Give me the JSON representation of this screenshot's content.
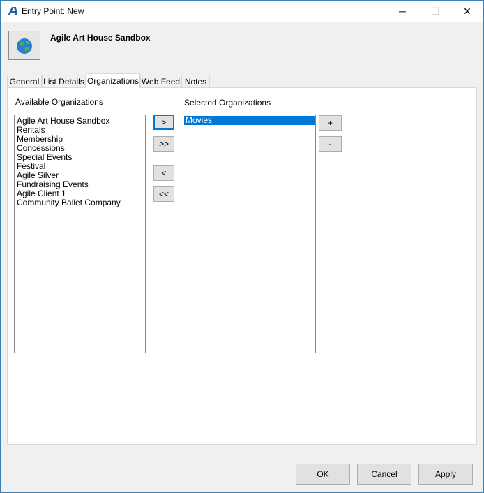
{
  "window": {
    "title": "Entry Point: New",
    "minimize_glyph": "─",
    "maximize_glyph": "☐",
    "close_glyph": "✕"
  },
  "header": {
    "title": "Agile Art House Sandbox"
  },
  "tabs": [
    {
      "label": "General"
    },
    {
      "label": "List Details"
    },
    {
      "label": "Organizations"
    },
    {
      "label": "Web Feed"
    },
    {
      "label": "Notes"
    }
  ],
  "active_tab": "Organizations",
  "organizations": {
    "available_label": "Available Organizations",
    "selected_label": "Selected Organizations",
    "available": [
      "Agile Art House Sandbox",
      "Rentals",
      "Membership",
      "Concessions",
      "Special Events",
      "Festival",
      "Agile Silver",
      "Fundraising Events",
      "Agile Client 1",
      "Community Ballet Company"
    ],
    "selected": [
      "Movies"
    ],
    "move_one_right": ">",
    "move_all_right": ">>",
    "move_one_left": "<",
    "move_all_left": "<<",
    "add": "+",
    "remove": "-"
  },
  "buttons": {
    "ok": "OK",
    "cancel": "Cancel",
    "apply": "Apply"
  },
  "colors": {
    "accent": "#0078d7",
    "window_border": "#3c7fb1",
    "app_icon": "#1f5fa8"
  }
}
